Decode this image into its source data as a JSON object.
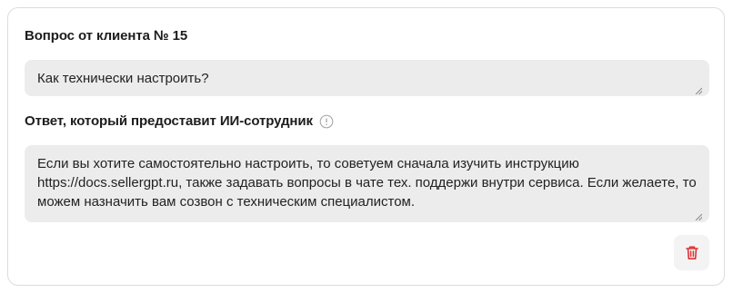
{
  "question": {
    "title": "Вопрос от клиента № 15",
    "value": "Как технически настроить?"
  },
  "answer": {
    "title": "Ответ, который предоставит ИИ-сотрудник",
    "info_icon": "info-circle-icon",
    "value": "Если вы хотите самостоятельно настроить, то советуем сначала изучить инструкцию https://docs.sellergpt.ru, также задавать вопросы в чате тех. поддержи внутри сервиса. Если желаете, то можем назначить вам созвон с техническим специалистом."
  },
  "actions": {
    "delete_icon": "trash-icon",
    "delete_color": "#e03131"
  }
}
